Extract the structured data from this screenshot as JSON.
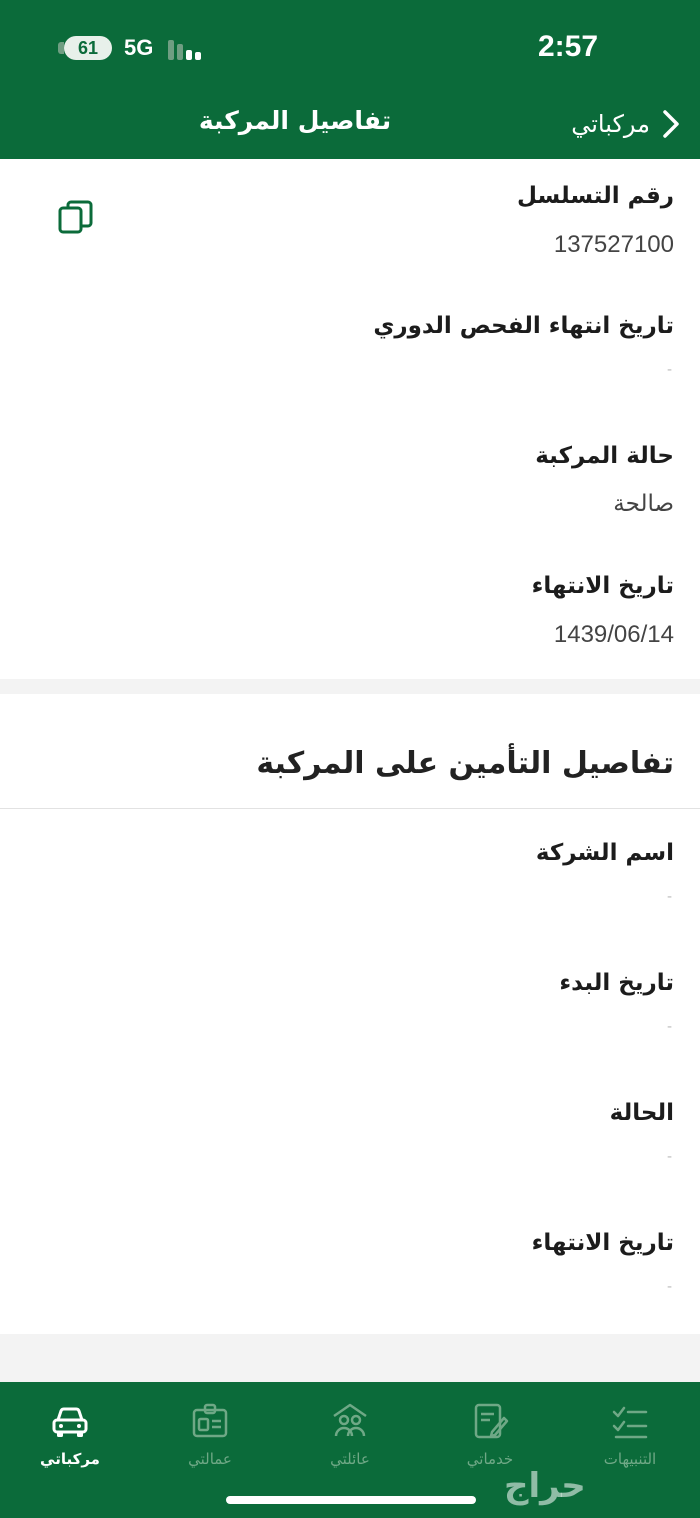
{
  "status_bar": {
    "battery": "61",
    "network": "5G",
    "time": "2:57"
  },
  "nav": {
    "back_label": "مركباتي",
    "title": "تفاصيل المركبة"
  },
  "vehicle_fields": [
    {
      "label": "رقم التسلسل",
      "value": "137527100"
    },
    {
      "label": "تاريخ انتهاء الفحص الدوري",
      "value": "-"
    },
    {
      "label": "حالة المركبة",
      "value": "صالحة"
    },
    {
      "label": "تاريخ الانتهاء",
      "value": "1439/06/14"
    }
  ],
  "insurance": {
    "title": "تفاصيل التأمين على المركبة",
    "fields": [
      {
        "label": "اسم الشركة",
        "value": "-"
      },
      {
        "label": "تاريخ البدء",
        "value": "-"
      },
      {
        "label": "الحالة",
        "value": "-"
      },
      {
        "label": "تاريخ الانتهاء",
        "value": "-"
      }
    ]
  },
  "bottom_nav": [
    {
      "label": "مركباتي",
      "icon": "car-icon",
      "active": true
    },
    {
      "label": "عمالتي",
      "icon": "id-card-icon",
      "active": false
    },
    {
      "label": "عائلتي",
      "icon": "family-icon",
      "active": false
    },
    {
      "label": "خدماتي",
      "icon": "services-icon",
      "active": false
    },
    {
      "label": "التنبيهات",
      "icon": "checklist-icon",
      "active": false
    }
  ],
  "watermark": "حراج",
  "colors": {
    "brand_green": "#0b6b3a",
    "inactive_tab": "#6fa886",
    "background": "#f3f3f3"
  }
}
